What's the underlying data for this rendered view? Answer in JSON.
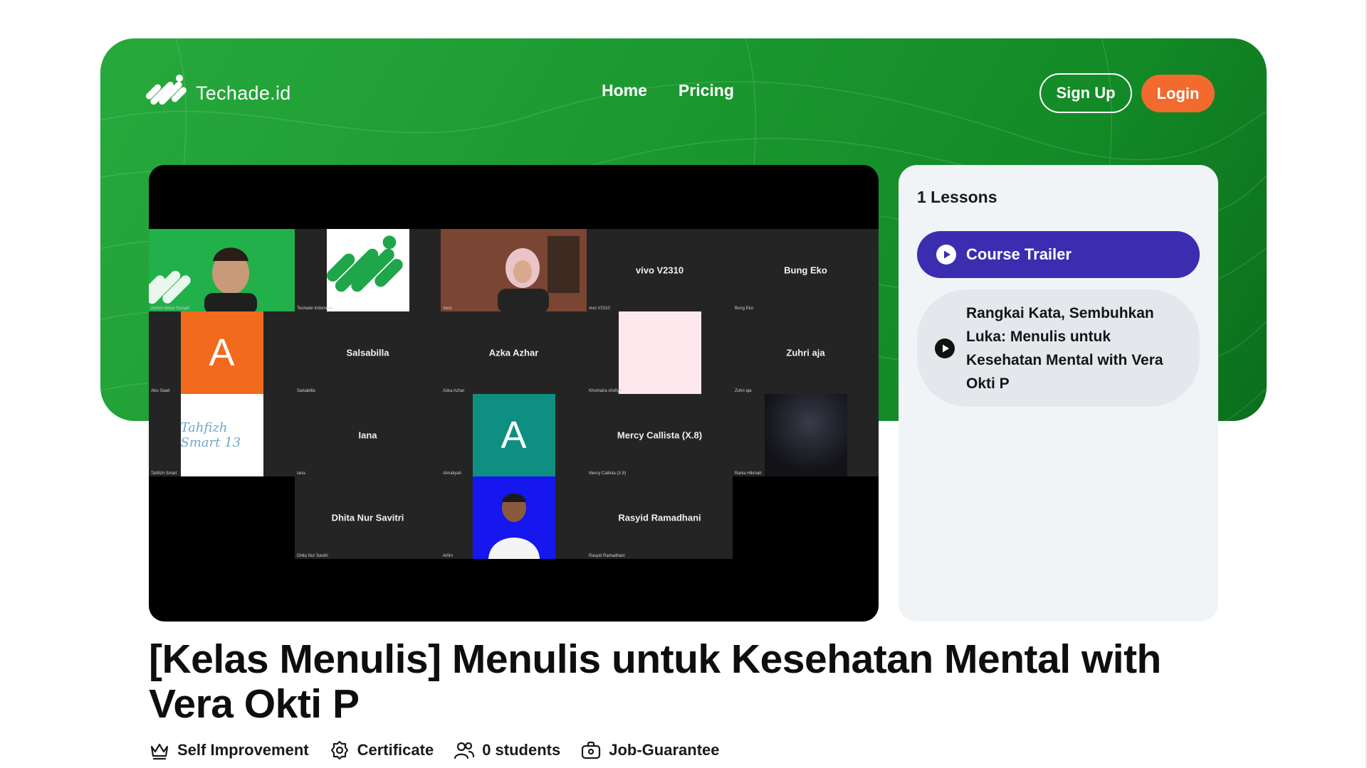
{
  "brand": {
    "name": "Techade.id"
  },
  "nav": {
    "home": "Home",
    "pricing": "Pricing"
  },
  "auth": {
    "signup": "Sign Up",
    "login": "Login"
  },
  "colors": {
    "hero_green": "#1c9a31",
    "login_orange": "#f26a2e",
    "active_lesson": "#3b2db0"
  },
  "video": {
    "participants": [
      {
        "name": "",
        "caption": "Achmi Akbar Rasyid",
        "kind": "camera-green"
      },
      {
        "name": "",
        "caption": "Techade Indonesia",
        "kind": "logo"
      },
      {
        "name": "",
        "caption": "Vera",
        "kind": "camera-brown"
      },
      {
        "name": "vivo V2310",
        "caption": "vivo V2310",
        "kind": "name"
      },
      {
        "name": "Bung Eko",
        "caption": "Bung Eko",
        "kind": "name"
      },
      {
        "name": "A",
        "caption": "Abu Saad",
        "kind": "avatar-orange"
      },
      {
        "name": "Salsabilla",
        "caption": "Salsabilla",
        "kind": "name"
      },
      {
        "name": "Azka Azhar",
        "caption": "Azka Azhar",
        "kind": "name"
      },
      {
        "name": "",
        "caption": "Khumaira shofiyy",
        "kind": "pink"
      },
      {
        "name": "Zuhri aja",
        "caption": "Zuhri aja",
        "kind": "name"
      },
      {
        "name": "Tahfizh Smart 13",
        "caption": "Tahfizh Smart",
        "kind": "tahfizh"
      },
      {
        "name": "Iana",
        "caption": "Iana",
        "kind": "name"
      },
      {
        "name": "A",
        "caption": "Almaliyah",
        "kind": "avatar-teal"
      },
      {
        "name": "Mercy Callista (X.8)",
        "caption": "Mercy Callista (X.8)",
        "kind": "name"
      },
      {
        "name": "",
        "caption": "Rania Hikmah",
        "kind": "moon"
      },
      {
        "name": "Dhita Nur Savitri",
        "caption": "Dhita Nur Savitri",
        "kind": "name"
      },
      {
        "name": "",
        "caption": "Arfim",
        "kind": "camera-blue"
      },
      {
        "name": "Rasyid Ramadhani",
        "caption": "Rasyid Ramadhani",
        "kind": "name"
      }
    ]
  },
  "lessons": {
    "count_label": "1 Lessons",
    "items": [
      {
        "label": "Course Trailer",
        "active": true
      },
      {
        "label": "Rangkai Kata, Sembuhkan Luka: Menulis untuk Kesehatan Mental with Vera Okti P",
        "active": false
      }
    ]
  },
  "course": {
    "title": "[Kelas Menulis] Menulis untuk Kesehatan Mental with Vera Okti P",
    "meta": [
      {
        "icon": "crown-icon",
        "label": "Self Improvement"
      },
      {
        "icon": "certificate-icon",
        "label": "Certificate"
      },
      {
        "icon": "users-icon",
        "label": "0 students"
      },
      {
        "icon": "briefcase-icon",
        "label": "Job-Guarantee"
      }
    ]
  }
}
